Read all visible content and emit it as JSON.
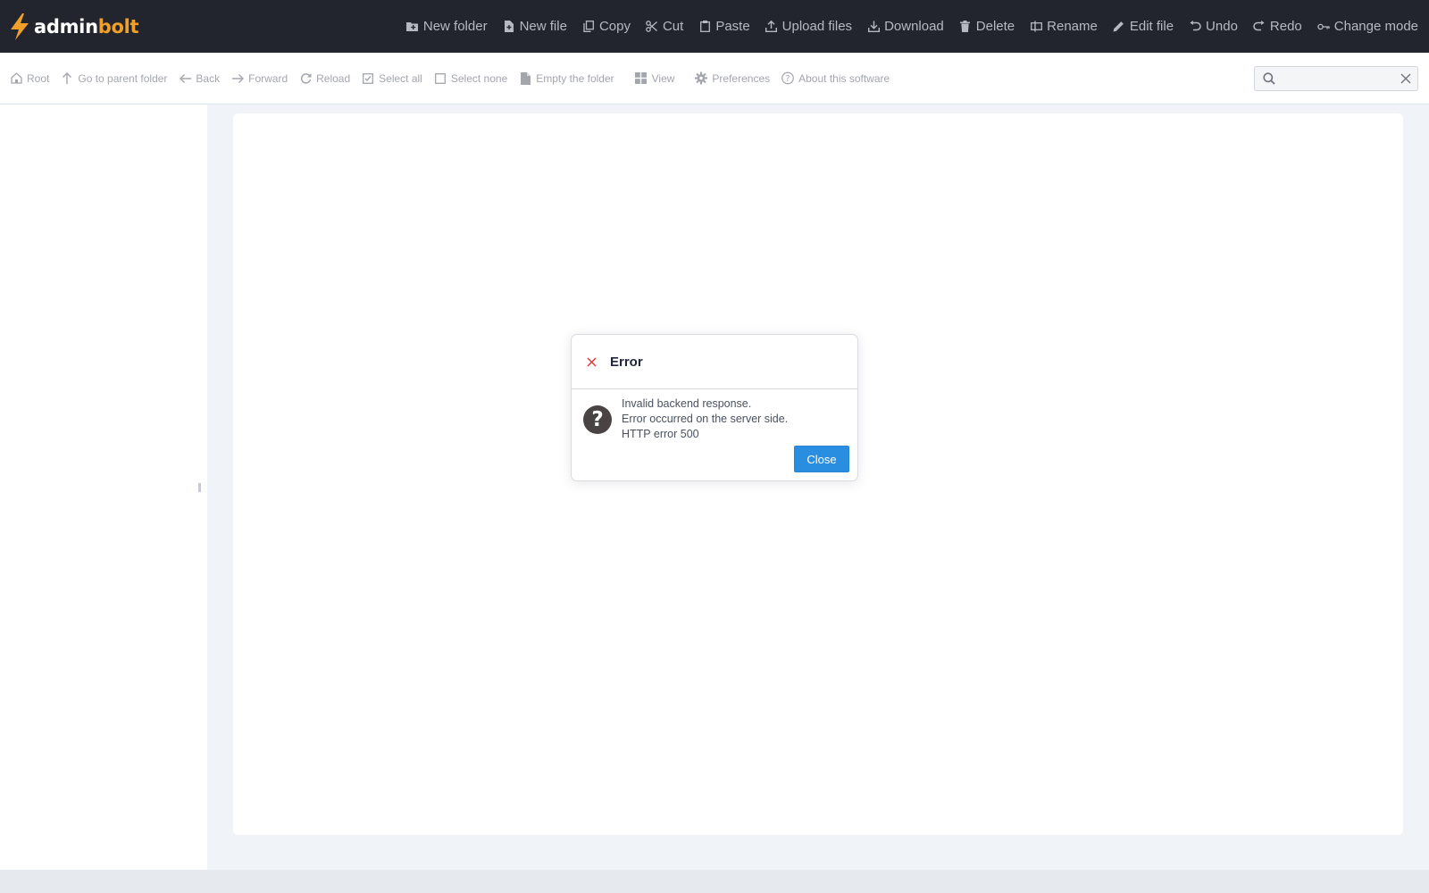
{
  "app": {
    "logo_part1": "admin",
    "logo_part2": "bolt",
    "logo_colors": {
      "text": "#ffffff",
      "accent": "#f0a02a"
    }
  },
  "top_actions": [
    {
      "label": "New folder",
      "icon": "new-folder-icon"
    },
    {
      "label": "New file",
      "icon": "new-file-icon"
    },
    {
      "label": "Copy",
      "icon": "copy-icon"
    },
    {
      "label": "Cut",
      "icon": "cut-icon"
    },
    {
      "label": "Paste",
      "icon": "paste-icon"
    },
    {
      "label": "Upload files",
      "icon": "upload-icon"
    },
    {
      "label": "Download",
      "icon": "download-icon"
    },
    {
      "label": "Delete",
      "icon": "trash-icon"
    },
    {
      "label": "Rename",
      "icon": "rename-icon"
    },
    {
      "label": "Edit file",
      "icon": "pencil-icon"
    },
    {
      "label": "Undo",
      "icon": "undo-icon"
    },
    {
      "label": "Redo",
      "icon": "redo-icon"
    },
    {
      "label": "Change mode",
      "icon": "key-icon"
    }
  ],
  "toolbar": [
    {
      "label": "Root",
      "icon": "home-icon"
    },
    {
      "label": "Go to parent folder",
      "icon": "arrow-up-icon"
    },
    {
      "label": "Back",
      "icon": "arrow-left-icon"
    },
    {
      "label": "Forward",
      "icon": "arrow-right-icon"
    },
    {
      "label": "Reload",
      "icon": "reload-icon"
    },
    {
      "label": "Select all",
      "icon": "checkbox-checked-icon"
    },
    {
      "label": "Select none",
      "icon": "checkbox-empty-icon"
    },
    {
      "label": "Empty the folder",
      "icon": "file-empty-icon"
    },
    {
      "label": "View",
      "icon": "grid-icon"
    },
    {
      "label": "Preferences",
      "icon": "gear-icon"
    },
    {
      "label": "About this software",
      "icon": "help-circle-icon"
    }
  ],
  "search": {
    "value": "",
    "placeholder": ""
  },
  "dialog": {
    "title": "Error",
    "messages": [
      "Invalid backend response.",
      "Error occurred on the server side.",
      "HTTP error 500"
    ],
    "close_label": "Close",
    "accent": "#2a8ee0"
  }
}
